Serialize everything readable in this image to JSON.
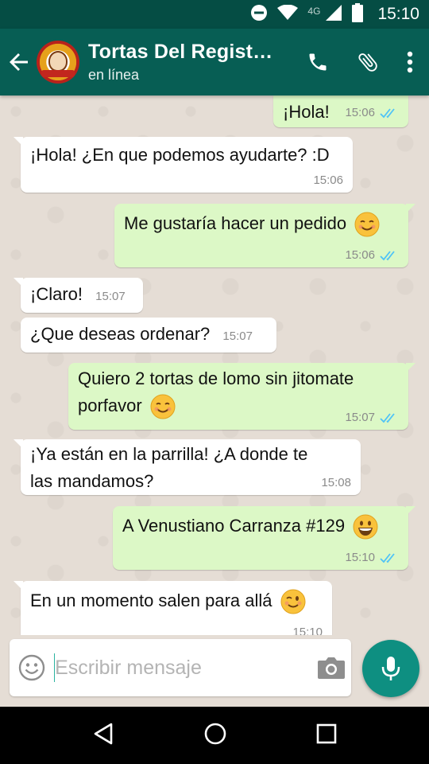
{
  "status_bar": {
    "network": "4G",
    "time": "15:10"
  },
  "header": {
    "chat_name": "Tortas Del Regist…",
    "chat_status": "en línea",
    "icons": [
      "back-arrow-icon",
      "avatar",
      "phone-icon",
      "paperclip-icon",
      "more-vert-icon"
    ]
  },
  "messages": [
    {
      "dir": "out",
      "text": "¡Hola!",
      "time": "15:06",
      "ticks": "read"
    },
    {
      "dir": "in",
      "text": "¡Hola! ¿En que podemos ayudarte? :D",
      "time": "15:06"
    },
    {
      "dir": "out",
      "text": "Me gustaría hacer un pedido",
      "emoji": "smiling-face",
      "time": "15:06",
      "ticks": "read"
    },
    {
      "dir": "in",
      "text": "¡Claro!",
      "time": "15:07"
    },
    {
      "dir": "in",
      "text": "¿Que deseas ordenar?",
      "time": "15:07"
    },
    {
      "dir": "out",
      "line1": "Quiero 2 tortas de lomo sin jitomate",
      "line2": "porfavor",
      "emoji": "smiling-face",
      "time": "15:07",
      "ticks": "read"
    },
    {
      "dir": "in",
      "line1": "¡Ya están en la parrilla! ¿A donde te",
      "line2": "las mandamos?",
      "time": "15:08"
    },
    {
      "dir": "out",
      "text": "A Venustiano Carranza #129",
      "emoji": "grinning-face",
      "time": "15:10",
      "ticks": "read"
    },
    {
      "dir": "in",
      "text": "En un momento salen para allá",
      "emoji": "winking-face",
      "time": "15:10"
    }
  ],
  "composer": {
    "placeholder": "Escribir mensaje"
  },
  "colors": {
    "header": "#075e54",
    "status_bar": "#054d44",
    "outgoing_bubble": "#dcf8c6",
    "incoming_bubble": "#ffffff",
    "read_ticks": "#4fc3f7",
    "mic_button": "#0e8f81"
  }
}
